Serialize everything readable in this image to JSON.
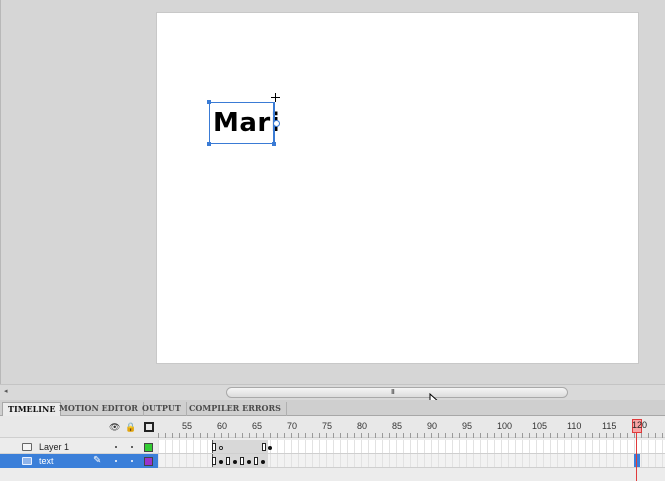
{
  "stage": {
    "text_value": "Mari"
  },
  "scrollbar": {
    "left_arrow": "◂",
    "grip": "III"
  },
  "tabs": [
    {
      "label": "TIMELINE",
      "active": true
    },
    {
      "label": "MOTION EDITOR",
      "active": false
    },
    {
      "label": "OUTPUT",
      "active": false
    },
    {
      "label": "COMPILER ERRORS",
      "active": false
    }
  ],
  "timeline": {
    "header_icons": {
      "eye": "👁",
      "lock": "🔒"
    },
    "frame_numbers": [
      "55",
      "60",
      "65",
      "70",
      "75",
      "80",
      "85",
      "90",
      "95",
      "100",
      "105",
      "110",
      "115",
      "120"
    ],
    "current_frame": "120",
    "layers": [
      {
        "name": "Layer 1",
        "color": "#33cc33",
        "selected": false
      },
      {
        "name": "text",
        "color": "#9933cc",
        "selected": true
      }
    ],
    "pencil_icon": "✎"
  },
  "colors": {
    "selection": "#3b7fd9",
    "playhead": "#e03a3a"
  }
}
